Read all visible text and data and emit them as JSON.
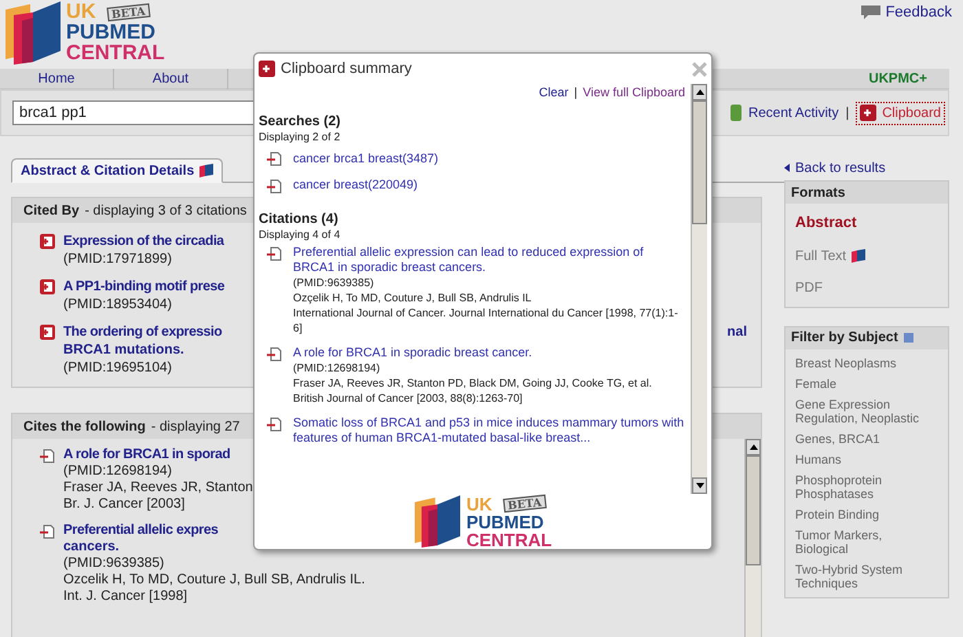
{
  "header": {
    "logo": {
      "line1": "UK",
      "line2": "PUBMED",
      "line3": "CENTRAL",
      "badge": "BETA"
    },
    "feedback": "Feedback"
  },
  "nav": {
    "items": [
      "Home",
      "About"
    ],
    "right_label": "UKPMC+"
  },
  "search": {
    "value": "brca1 pp1",
    "recent_activity": "Recent Activity",
    "separator": "|",
    "clipboard": "Clipboard"
  },
  "tabs": [
    {
      "label": "Abstract & Citation Details",
      "selected": true
    }
  ],
  "cited_by": {
    "title": "Cited By",
    "subtitle": "- displaying 3 of 3 citations",
    "items": [
      {
        "title": "Expression of the circadia",
        "pmid": "(PMID:17971899)"
      },
      {
        "title": "A PP1-binding motif prese",
        "pmid": "(PMID:18953404)"
      },
      {
        "title": "The ordering of expressio",
        "title_end": "nal",
        "title_line2": "BRCA1 mutations.",
        "pmid": "(PMID:19695104)"
      }
    ]
  },
  "cites": {
    "title": "Cites the following",
    "subtitle": "- displaying 27",
    "items": [
      {
        "title": "A role for BRCA1 in sporad",
        "pmid": "(PMID:12698194)",
        "lines": [
          "Fraser JA, Reeves JR, Stanton",
          "Br. J. Cancer [2003]"
        ]
      },
      {
        "title": "Preferential allelic expres",
        "title_line2": "cancers.",
        "pmid": "(PMID:9639385)",
        "lines": [
          "Ozcelik H, To MD, Couture J, Bull SB, Andrulis IL.",
          "Int. J. Cancer [1998]"
        ]
      }
    ]
  },
  "sidebar": {
    "back": "Back to results",
    "formats": {
      "title": "Formats",
      "items": [
        {
          "label": "Abstract",
          "selected": true,
          "icon": false
        },
        {
          "label": "Full Text",
          "selected": false,
          "icon": true
        },
        {
          "label": "PDF",
          "selected": false,
          "icon": false
        }
      ]
    },
    "filter": {
      "title": "Filter by Subject",
      "items": [
        "Breast Neoplasms",
        "Female",
        "Gene Expression Regulation, Neoplastic",
        "Genes, BRCA1",
        "Humans",
        "Phosphoprotein Phosphatases",
        "Protein Binding",
        "Tumor Markers, Biological",
        "Two-Hybrid System Techniques"
      ]
    }
  },
  "modal": {
    "title": "Clipboard summary",
    "clear": "Clear",
    "separator": "|",
    "view_full": "View full Clipboard",
    "searches": {
      "title": "Searches (2)",
      "subtitle": "Displaying 2 of 2",
      "items": [
        "cancer brca1 breast(3487)",
        "cancer breast(220049)"
      ]
    },
    "citations": {
      "title": "Citations (4)",
      "subtitle": "Displaying 4 of 4",
      "items": [
        {
          "title": "Preferential allelic expression can lead to reduced expression of BRCA1 in sporadic breast cancers.",
          "pmid": "(PMID:9639385)",
          "lines": [
            "Ozçelik H, To MD, Couture J, Bull SB, Andrulis IL",
            "International Journal of Cancer. Journal International du Cancer [1998, 77(1):1-6]"
          ]
        },
        {
          "title": "A role for BRCA1 in sporadic breast cancer.",
          "pmid": "(PMID:12698194)",
          "lines": [
            "Fraser JA, Reeves JR, Stanton PD, Black DM, Going JJ, Cooke TG, et al.",
            "British Journal of Cancer [2003, 88(8):1263-70]"
          ]
        },
        {
          "title": "Somatic loss of BRCA1 and p53 in mice induces mammary tumors with features of human BRCA1-mutated basal-like breast..."
        }
      ]
    },
    "logo": {
      "line1": "UK",
      "line2": "PUBMED",
      "line3": "CENTRAL",
      "badge": "BETA"
    }
  }
}
